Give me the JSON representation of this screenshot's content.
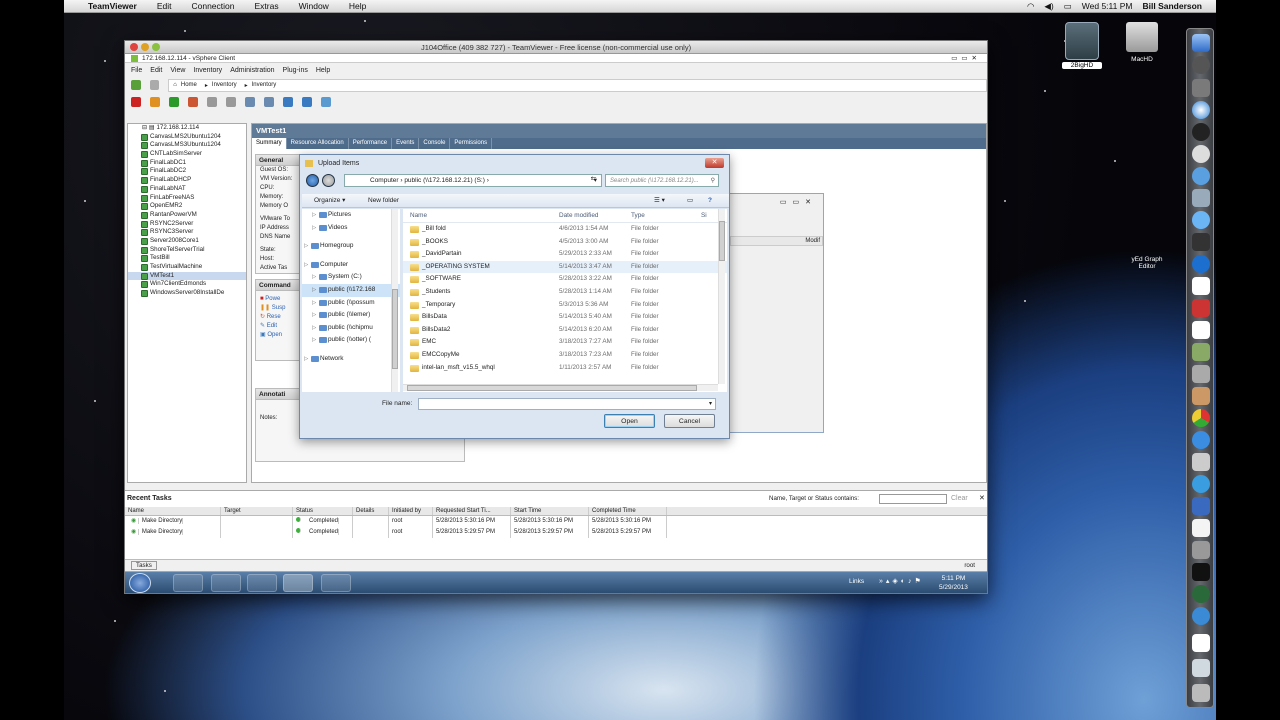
{
  "mac_menubar": {
    "app": "TeamViewer",
    "menus": [
      "Edit",
      "Connection",
      "Extras",
      "Window",
      "Help"
    ],
    "clock": "Wed 5:11 PM",
    "user": "Bill Sanderson"
  },
  "desktop_icons": [
    {
      "label": "2BigHD"
    },
    {
      "label": "MacHD"
    },
    {
      "label": "yEd Graph Editor"
    }
  ],
  "teamviewer": {
    "title": "J104Office (409 382 727) - TeamViewer - Free license (non-commercial use only)"
  },
  "vsphere": {
    "title": "172.168.12.114 - vSphere Client",
    "menus": [
      "File",
      "Edit",
      "View",
      "Inventory",
      "Administration",
      "Plug-ins",
      "Help"
    ],
    "breadcrumb": [
      "Home",
      "Inventory",
      "Inventory"
    ],
    "tree_root": "172.168.12.114",
    "vms": [
      "CanvasLMS2Ubuntu1204",
      "CanvasLMS3Ubuntu1204",
      "CNTLabSimServer",
      "FinalLabDC1",
      "FinalLabDC2",
      "FinalLabDHCP",
      "FinalLabNAT",
      "FinLabFreeNAS",
      "OpenEMR2",
      "RantanPowerVM",
      "RSYNC2Server",
      "RSYNC3Server",
      "Server2008Core1",
      "ShoreTelServerTrial",
      "TestBill",
      "TestVirtualMachine",
      "VMTest1",
      "Win7ClientEdmonds",
      "WindowsServer08InstallDe"
    ],
    "selected_vm": "VMTest1",
    "tabs": [
      "Summary",
      "Resource Allocation",
      "Performance",
      "Events",
      "Console",
      "Permissions"
    ],
    "general_title": "General",
    "general_fields": [
      "Guest OS:",
      "VM Version:",
      "CPU:",
      "Memory:",
      "Memory O",
      "",
      "VMware To",
      "IP Address",
      "DNS Name",
      "",
      "State:",
      "Host:",
      "Active Tas"
    ],
    "commands_title": "Command",
    "commands": [
      "Powe",
      "Susp",
      "Rese",
      "Edit",
      "Open"
    ],
    "annotations_title": "Annotati",
    "notes_label": "Notes:",
    "recent_tasks": "Recent Tasks",
    "filter_label": "Name, Target or Status contains:",
    "clear": "Clear",
    "task_columns": [
      "Name",
      "Target",
      "Status",
      "Details",
      "Initiated by",
      "Requested Start Ti...",
      "Start Time",
      "Completed Time"
    ],
    "task_rows": [
      {
        "name": "Make Directory",
        "target": "",
        "status": "Completed",
        "details": "",
        "by": "root",
        "req": "5/28/2013 5:30:16 PM",
        "start": "5/28/2013 5:30:16 PM",
        "done": "5/28/2013 5:30:16 PM"
      },
      {
        "name": "Make Directory",
        "target": "",
        "status": "Completed",
        "details": "",
        "by": "root",
        "req": "5/28/2013 5:29:57 PM",
        "start": "5/28/2013 5:29:57 PM",
        "done": "5/28/2013 5:29:57 PM"
      }
    ],
    "status_tasks": "Tasks",
    "status_user": "root",
    "behind_col": "Modif"
  },
  "win_taskbar": {
    "links": "Links",
    "time": "5:11 PM",
    "date": "5/29/2013"
  },
  "upload_dialog": {
    "title": "Upload Items",
    "address": "Computer  ›  public (\\\\172.168.12.21) (S:)  ›",
    "search_placeholder": "Search public (\\\\172.168.12.21)...",
    "organize": "Organize ▾",
    "new_folder": "New folder",
    "nav_items": [
      {
        "label": "Pictures",
        "indent": 1
      },
      {
        "label": "Videos",
        "indent": 1
      },
      {
        "label": "",
        "indent": 0
      },
      {
        "label": "Homegroup",
        "indent": 0
      },
      {
        "label": "",
        "indent": 0
      },
      {
        "label": "Computer",
        "indent": 0
      },
      {
        "label": "System (C:)",
        "indent": 1
      },
      {
        "label": "public (\\\\172.168",
        "indent": 1
      },
      {
        "label": "public (\\\\possum",
        "indent": 1
      },
      {
        "label": "public (\\\\lemer)",
        "indent": 1
      },
      {
        "label": "public (\\\\chipmu",
        "indent": 1
      },
      {
        "label": "public (\\\\otter) (",
        "indent": 1
      },
      {
        "label": "",
        "indent": 0
      },
      {
        "label": "Network",
        "indent": 0
      }
    ],
    "columns": [
      "Name",
      "Date modified",
      "Type",
      "Si"
    ],
    "files": [
      {
        "name": "_Bill fold",
        "date": "4/6/2013 1:54 AM",
        "type": "File folder"
      },
      {
        "name": "_BOOKS",
        "date": "4/5/2013 3:00 AM",
        "type": "File folder"
      },
      {
        "name": "_DavidPartain",
        "date": "5/29/2013 2:33 AM",
        "type": "File folder"
      },
      {
        "name": "_OPERATING SYSTEM",
        "date": "5/14/2013 3:47 AM",
        "type": "File folder"
      },
      {
        "name": "_SOFTWARE",
        "date": "5/28/2013 3:22 AM",
        "type": "File folder"
      },
      {
        "name": "_Students",
        "date": "5/28/2013 1:14 AM",
        "type": "File folder"
      },
      {
        "name": "_Temporary",
        "date": "5/3/2013 5:36 AM",
        "type": "File folder"
      },
      {
        "name": "BillsData",
        "date": "5/14/2013 5:40 AM",
        "type": "File folder"
      },
      {
        "name": "BillsData2",
        "date": "5/14/2013 6:20 AM",
        "type": "File folder"
      },
      {
        "name": "EMC",
        "date": "3/18/2013 7:27 AM",
        "type": "File folder"
      },
      {
        "name": "EMCCopyMe",
        "date": "3/18/2013 7:23 AM",
        "type": "File folder"
      },
      {
        "name": "intel-lan_msft_v15.5_whql",
        "date": "1/11/2013 2:57 AM",
        "type": "File folder"
      }
    ],
    "file_name_label": "File name:",
    "file_name_value": "",
    "open": "Open",
    "cancel": "Cancel"
  }
}
